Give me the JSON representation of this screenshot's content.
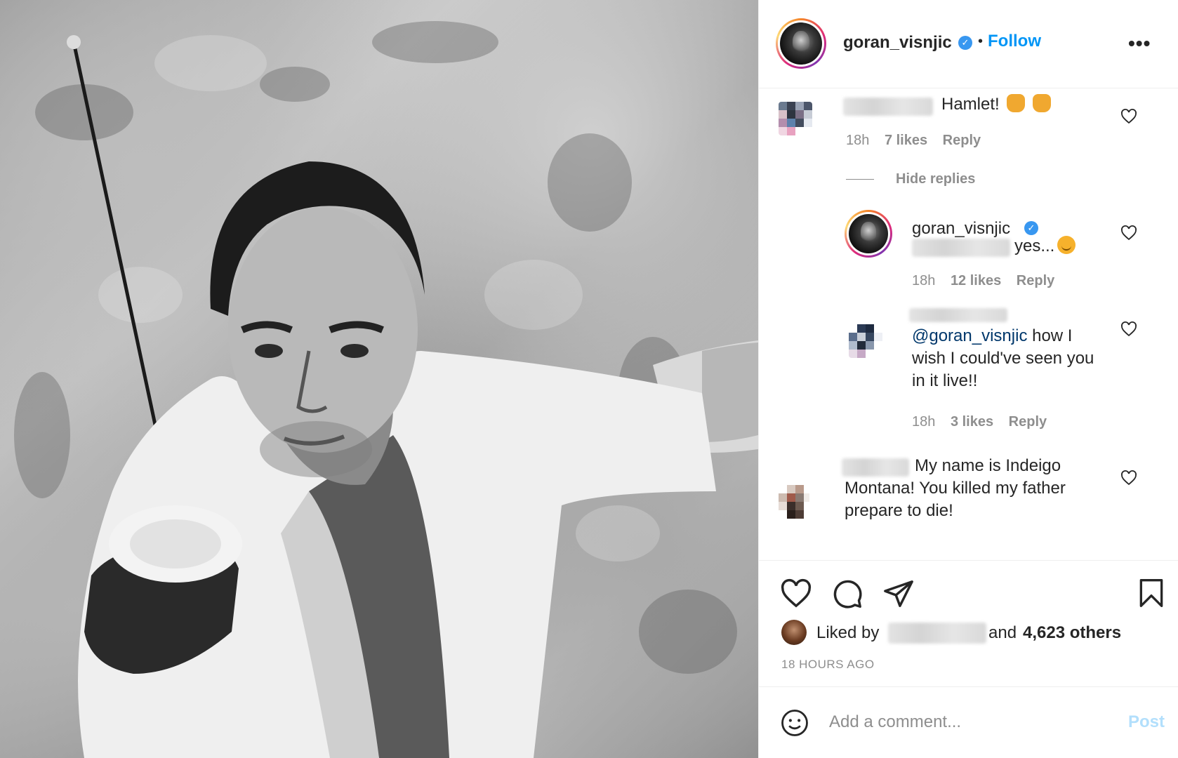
{
  "post": {
    "author": "goran_visnjic",
    "separator": "•",
    "follow_label": "Follow",
    "more_label": "•••",
    "verified_mark": "✓"
  },
  "comments": [
    {
      "text": "Hamlet!",
      "time": "18h",
      "likes": "7 likes",
      "reply": "Reply",
      "hide_replies": "Hide replies",
      "replies": [
        {
          "username": "goran_visnjic",
          "text": "yes...",
          "time": "18h",
          "likes": "12 likes",
          "reply": "Reply"
        },
        {
          "mention": "@goran_visnjic",
          "text_line1": " how I",
          "text_line2": "wish I could've seen you",
          "text_line3": "in it live!!",
          "time": "18h",
          "likes": "3 likes",
          "reply": "Reply"
        }
      ]
    },
    {
      "text_line1": "My name is Indeigo",
      "text_line2": "Montana! You killed my father",
      "text_line3": "prepare to die!"
    }
  ],
  "actions": {
    "liked_by_prefix": "Liked by",
    "liked_by_suffix": "and",
    "others": "4,623 others",
    "time_ago": "18 HOURS AGO"
  },
  "add_comment": {
    "placeholder": "Add a comment...",
    "post_label": "Post"
  },
  "colors": {
    "accent": "#0095f6",
    "verified": "#3897f0",
    "muted": "#8e8e8e",
    "post_disabled": "#b2dffc"
  },
  "icons": [
    "photo",
    "verified-badge-icon",
    "more-options-icon",
    "heart-icon",
    "comment-icon",
    "share-icon",
    "bookmark-icon",
    "emoji-icon",
    "clap-emoji-icon",
    "raised-hands-emoji-icon",
    "smile-emoji-icon"
  ]
}
